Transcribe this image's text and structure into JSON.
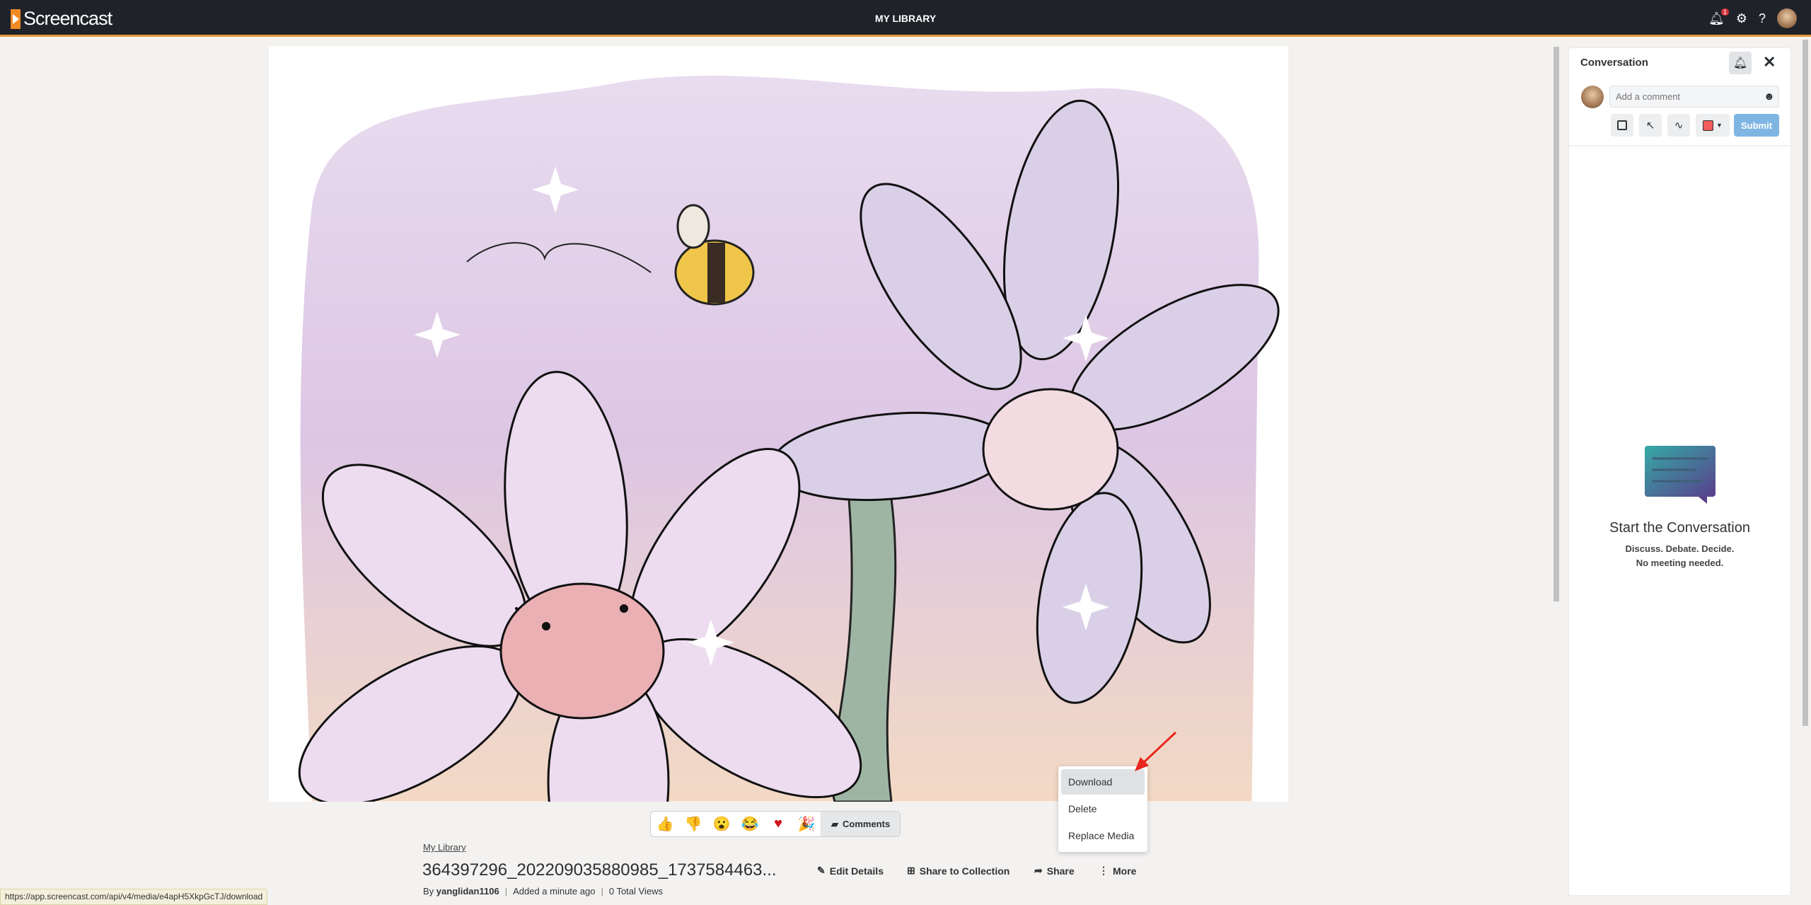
{
  "header": {
    "logo": "Screencast",
    "title": "MY LIBRARY",
    "notification_count": "1",
    "icons": [
      "bell-icon",
      "gear-icon",
      "help-icon",
      "avatar"
    ]
  },
  "conversation": {
    "title": "Conversation",
    "comment_placeholder": "Add a comment",
    "submit_label": "Submit",
    "selected_color": "#f25c5c",
    "tools": [
      "rectangle-tool",
      "arrow-tool",
      "freehand-tool",
      "color-picker"
    ],
    "empty_title": "Start the Conversation",
    "empty_line1": "Discuss. Debate. Decide.",
    "empty_line2": "No meeting needed."
  },
  "reactions": {
    "items": [
      "thumbs-up",
      "thumbs-down",
      "surprised",
      "laughing",
      "heart",
      "party-popper"
    ],
    "comments_label": "Comments"
  },
  "media": {
    "breadcrumb": "My Library",
    "title": "364397296_202209035880985_1737584463...",
    "author_prefix": "By",
    "author": "yanglidan1106",
    "added": "Added a minute ago",
    "views": "0 Total Views"
  },
  "actions": {
    "edit": "Edit Details",
    "share_collection": "Share to Collection",
    "share": "Share",
    "more": "More"
  },
  "more_menu": {
    "items": [
      "Download",
      "Delete",
      "Replace Media"
    ],
    "highlighted": "Download"
  },
  "status_url": "https://app.screencast.com/api/v4/media/e4apH5XkpGcTJ/download",
  "colors": {
    "header_bg": "#1f2329",
    "accent": "#f08a24",
    "submit": "#7fb5e3"
  }
}
